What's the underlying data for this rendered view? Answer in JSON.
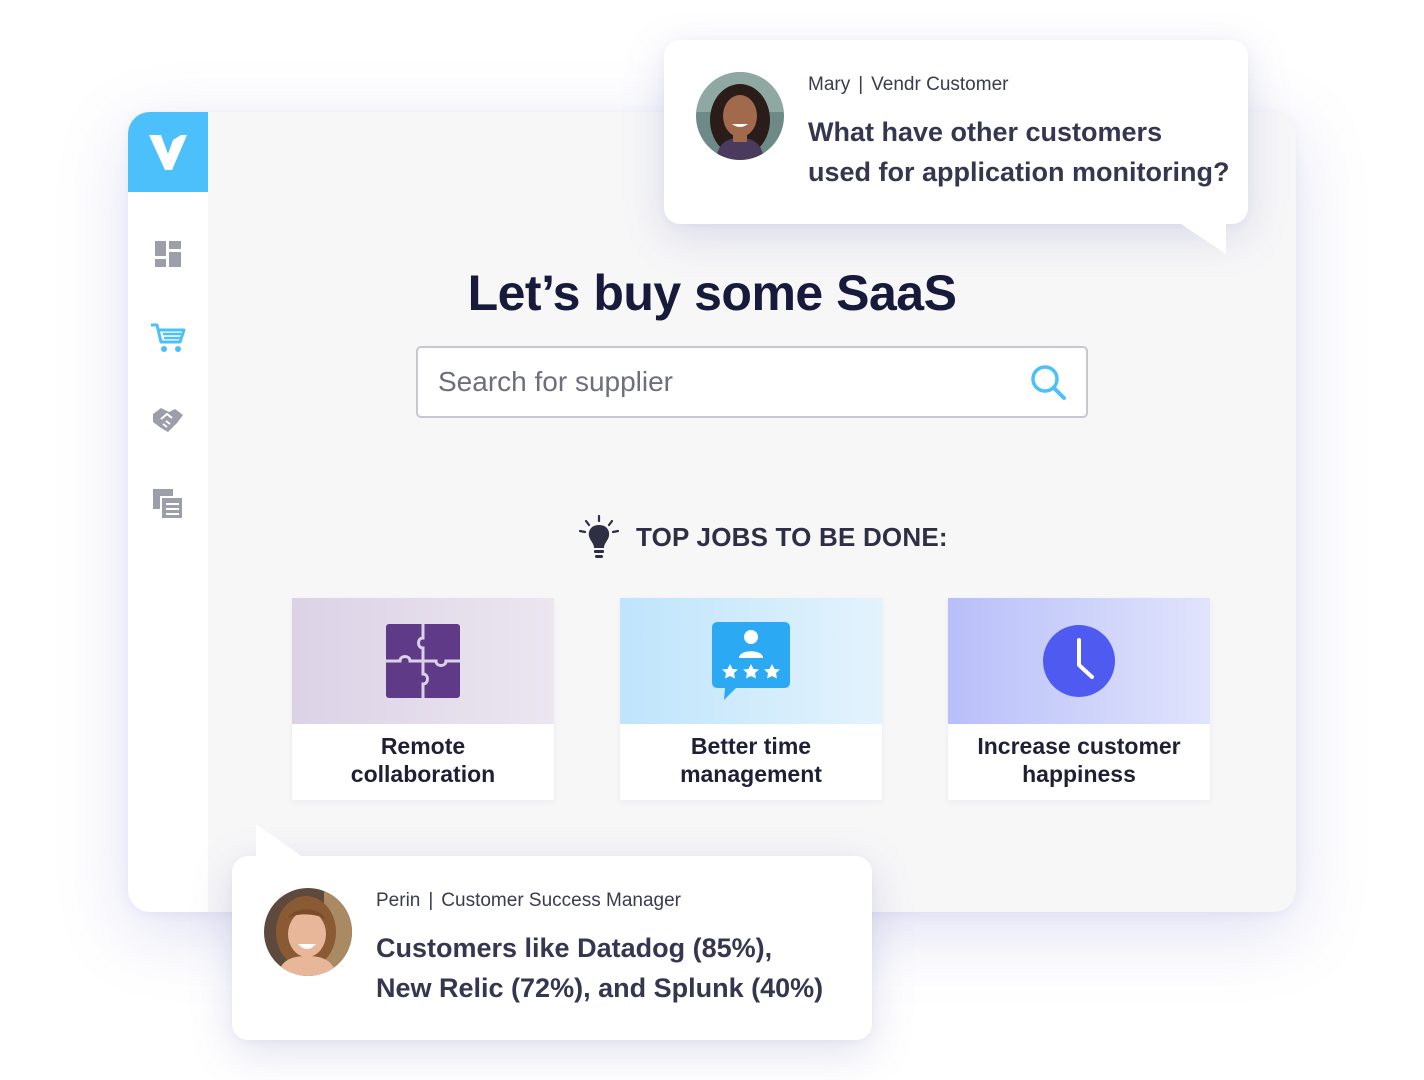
{
  "app": {
    "logo_letter": "V",
    "nav": [
      {
        "icon": "dashboard-icon"
      },
      {
        "icon": "shopping-cart-icon",
        "active": true
      },
      {
        "icon": "handshake-icon"
      },
      {
        "icon": "documents-icon"
      }
    ],
    "accent_color": "#4cc0fb"
  },
  "main": {
    "title": "Let’s buy some SaaS",
    "search": {
      "placeholder": "Search for supplier",
      "value": ""
    },
    "jobs_header": "TOP JOBS TO BE DONE:",
    "jobs": [
      {
        "title_line1": "Remote",
        "title_line2": "collaboration",
        "icon": "puzzle-icon",
        "color": "#5f3b87"
      },
      {
        "title_line1": "Better time",
        "title_line2": "management",
        "icon": "rating-chat-icon",
        "color": "#2ba9f3"
      },
      {
        "title_line1": "Increase customer",
        "title_line2": "happiness",
        "icon": "clock-icon",
        "color": "#4f5bf0"
      }
    ]
  },
  "chat": {
    "customer": {
      "name": "Mary",
      "role": "Vendr Customer",
      "separator": "|",
      "message_line1": "What have other customers",
      "message_line2": "used for application monitoring?"
    },
    "agent": {
      "name": "Perin",
      "role": "Customer Success Manager",
      "separator": "|",
      "message_line1": "Customers like Datadog (85%),",
      "message_line2": "New Relic (72%), and Splunk (40%)"
    }
  }
}
